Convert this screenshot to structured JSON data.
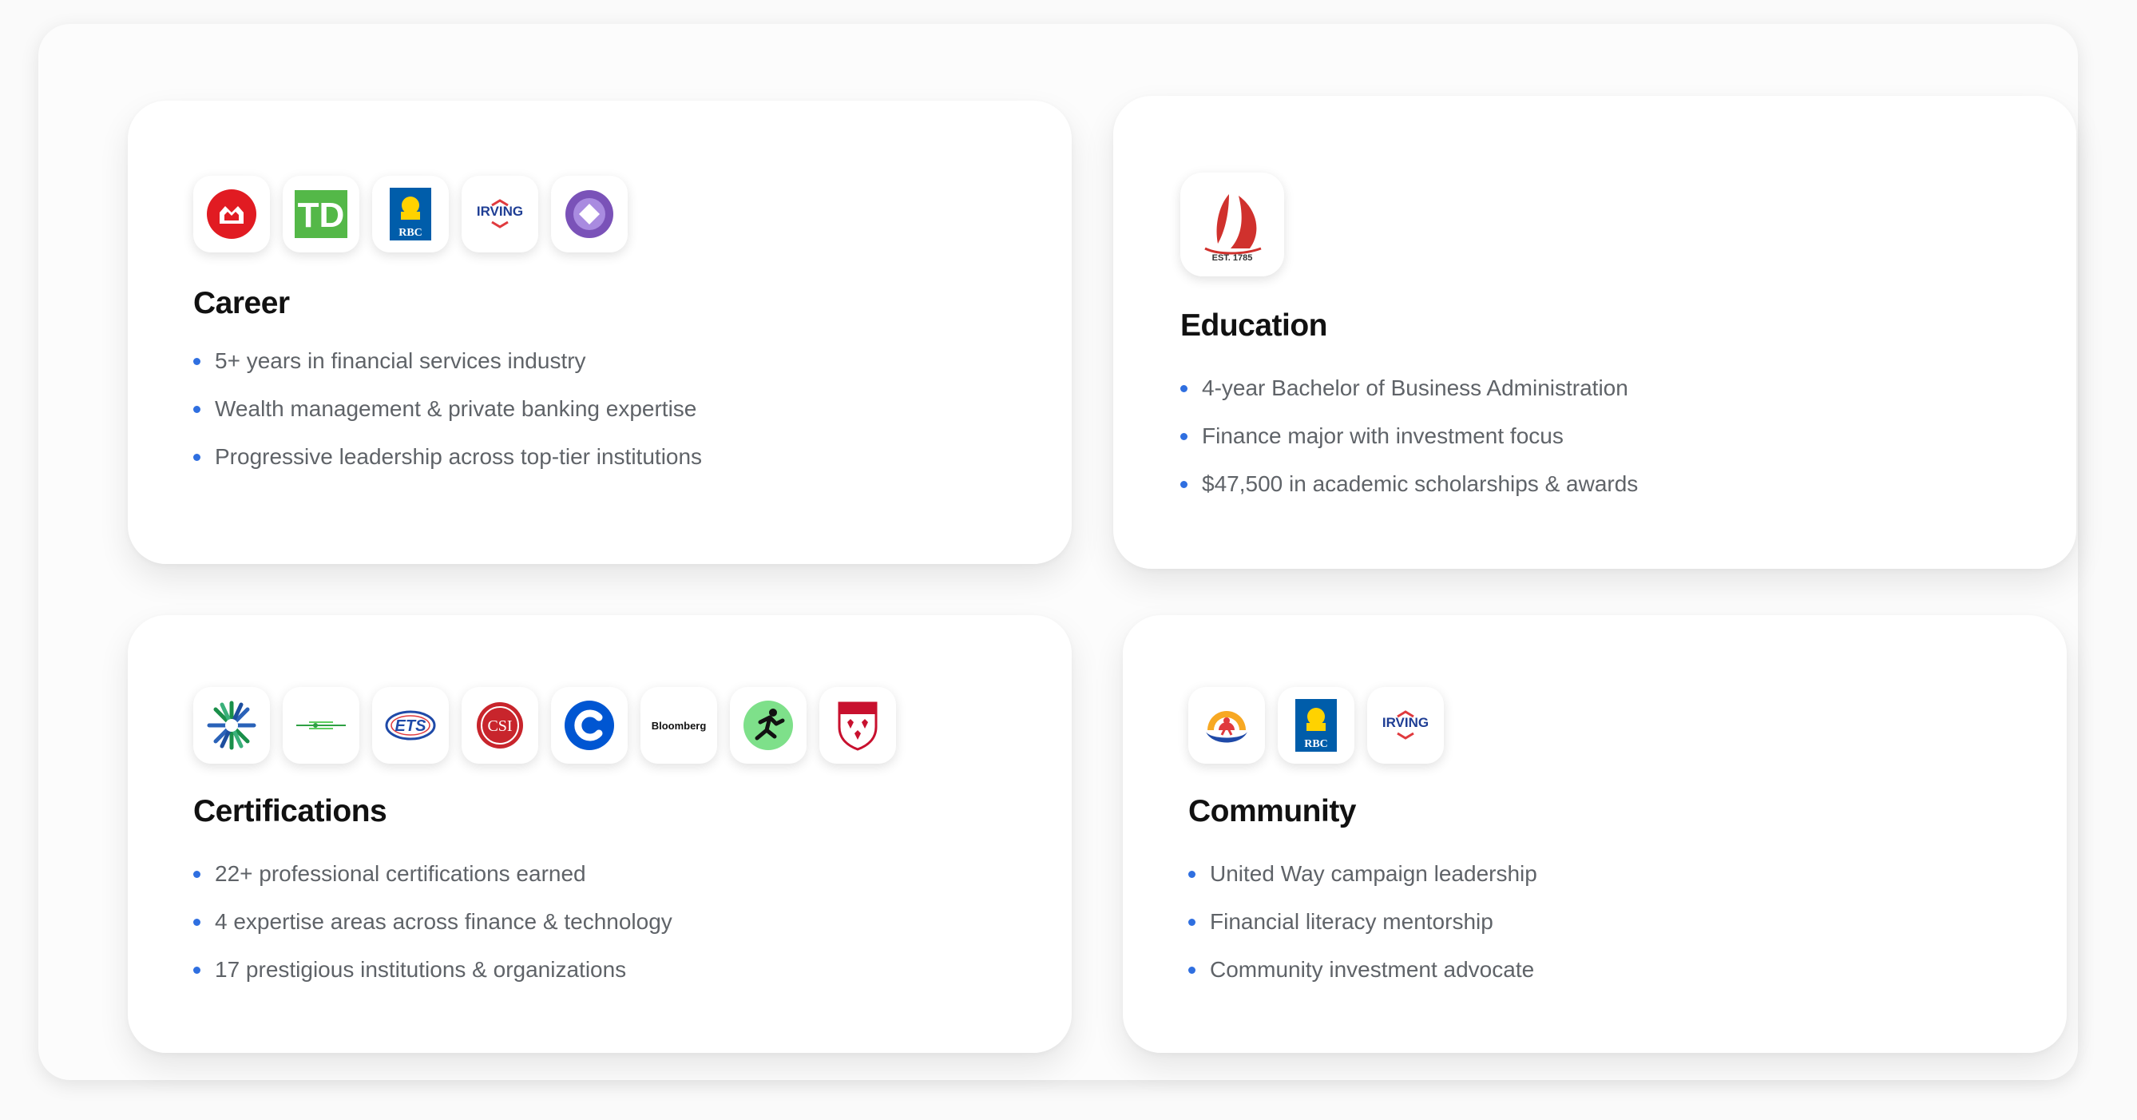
{
  "career": {
    "title": "Career",
    "logos": [
      {
        "name": "bmo-logo-icon",
        "color": "#e11b22"
      },
      {
        "name": "td-logo-icon",
        "color": "#54b848"
      },
      {
        "name": "rbc-logo-icon",
        "color": "#005daa"
      },
      {
        "name": "irving-logo-icon",
        "text": "IRVING"
      },
      {
        "name": "purple-circle-logo-icon",
        "color": "#7a52b8"
      }
    ],
    "items": [
      "5+ years in financial services industry",
      "Wealth management & private banking expertise",
      "Progressive leadership across top-tier institutions"
    ]
  },
  "education": {
    "title": "Education",
    "logo": {
      "name": "unb-sail-logo-icon",
      "text": "EST. 1785",
      "color": "#d0312d"
    },
    "items": [
      "4-year Bachelor of Business Administration",
      "Finance major with investment focus",
      "$47,500 in academic scholarships & awards"
    ]
  },
  "certifications": {
    "title": "Certifications",
    "logos": [
      {
        "name": "green-blue-burst-logo-icon"
      },
      {
        "name": "green-lines-logo-icon"
      },
      {
        "name": "ets-logo-icon",
        "text": "ETS"
      },
      {
        "name": "csi-logo-icon",
        "text": "CSI",
        "color": "#c8252c"
      },
      {
        "name": "coursera-logo-icon",
        "text": "C",
        "color": "#0056d2"
      },
      {
        "name": "bloomberg-logo-icon",
        "text": "Bloomberg"
      },
      {
        "name": "runner-logo-icon",
        "color": "#7ee08a"
      },
      {
        "name": "mcgill-crest-logo-icon",
        "color": "#c8102e"
      }
    ],
    "items": [
      "22+ professional certifications earned",
      "4 expertise areas across finance & technology",
      "17 prestigious institutions & organizations"
    ]
  },
  "community": {
    "title": "Community",
    "logos": [
      {
        "name": "united-way-logo-icon"
      },
      {
        "name": "rbc-logo-icon",
        "color": "#005daa"
      },
      {
        "name": "irving-logo-icon",
        "text": "IRVING"
      }
    ],
    "items": [
      "United Way campaign leadership",
      "Financial literacy mentorship",
      "Community investment advocate"
    ]
  },
  "colors": {
    "bullet": "#2f6fe0",
    "heading": "#111111",
    "body_text": "#5f6368"
  }
}
